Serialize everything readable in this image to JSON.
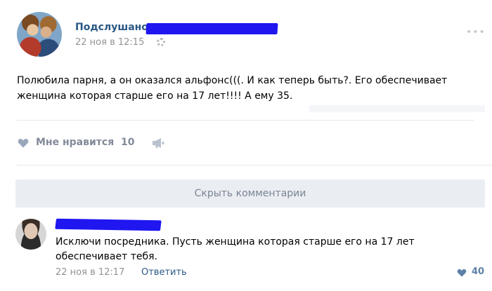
{
  "post": {
    "group_name": "Подслушано",
    "date": "22 ноя в 12:15",
    "text": "Полюбила парня, а он оказался альфонс(((. И как теперь быть?. Его обеспечивает женщина которая старше его на 17 лет!!!! А ему 35.",
    "like_label": "Мне нравится",
    "like_count": "10"
  },
  "comments_bar": {
    "hide_label": "Скрыть комментарии"
  },
  "comment": {
    "text": "Исключи посредника. Пусть женщина которая старше его на 17 лет обеспечивает тебя.",
    "date": "22 ноя в 12:17",
    "reply_label": "Ответить",
    "like_count": "40"
  },
  "colors": {
    "link_blue": "#2a5885",
    "redaction": "#1f16f0",
    "muted_gray": "#939393",
    "button_bg": "#eaedf2"
  },
  "icons": {
    "more": "more-dots-icon",
    "settings": "gear-icon",
    "like": "heart-icon",
    "share": "megaphone-icon"
  }
}
